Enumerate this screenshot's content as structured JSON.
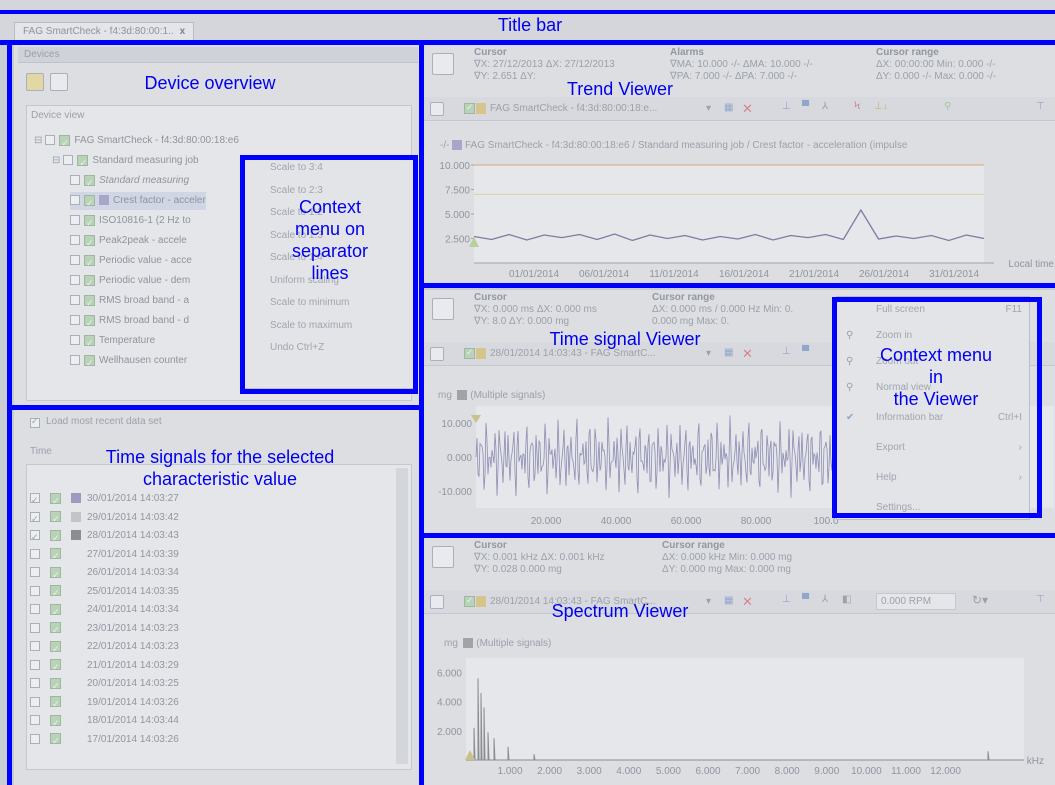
{
  "window": {
    "tab_label": "FAG SmartCheck - f4:3d:80:00:1..",
    "tab_close": "x"
  },
  "annotations": {
    "title_bar": "Title bar",
    "device_overview": "Device overview",
    "context_separator": "Context\nmenu on\nseparator\nlines",
    "time_signals": "Time signals for the selected\ncharacteristic value",
    "trend_viewer": "Trend Viewer",
    "time_signal_viewer": "Time signal Viewer",
    "context_viewer": "Context menu\nin\nthe Viewer",
    "spectrum_viewer": "Spectrum Viewer"
  },
  "devices": {
    "header": "Devices",
    "device_view_label": "Device view",
    "tree": [
      {
        "label": "FAG SmartCheck - f4:3d:80:00:18:e6",
        "level": 0
      },
      {
        "label": "Standard measuring job",
        "level": 1
      },
      {
        "label": "Standard measuring",
        "level": 2,
        "italic": true
      },
      {
        "label": "Crest factor - acceler",
        "level": 2,
        "selected": true
      },
      {
        "label": "ISO10816-1 (2 Hz to",
        "level": 2
      },
      {
        "label": "Peak2peak - accele",
        "level": 2
      },
      {
        "label": "Periodic value - acce",
        "level": 2
      },
      {
        "label": "Periodic value - dem",
        "level": 2
      },
      {
        "label": "RMS broad band - a",
        "level": 2
      },
      {
        "label": "RMS broad band - d",
        "level": 2
      },
      {
        "label": "Temperature",
        "level": 2
      },
      {
        "label": "Wellhausen counter",
        "level": 2
      }
    ]
  },
  "separator_menu": {
    "items": [
      "Scale to 3:4",
      "Scale to 2:3",
      "Scale to 1:2",
      "Scale to 1:3",
      "Scale to 1:4",
      "Uniform scaling",
      "Scale to minimum",
      "Scale to maximum",
      "Undo   Ctrl+Z"
    ]
  },
  "time_signals": {
    "load_recent": "Load most recent data set",
    "time_col": "Time",
    "rows": [
      {
        "date": "30/01/2014 14:03:27",
        "checked": true,
        "color": "#9d9ac2"
      },
      {
        "date": "29/01/2014 14:03:42",
        "checked": true,
        "color": "#c3c4c8"
      },
      {
        "date": "28/01/2014 14:03:43",
        "checked": true,
        "color": "#8c8d91"
      },
      {
        "date": "27/01/2014 14:03:39",
        "checked": false,
        "color": ""
      },
      {
        "date": "26/01/2014 14:03:34",
        "checked": false,
        "color": ""
      },
      {
        "date": "25/01/2014 14:03:35",
        "checked": false,
        "color": ""
      },
      {
        "date": "24/01/2014 14:03:34",
        "checked": false,
        "color": ""
      },
      {
        "date": "23/01/2014 14:03:23",
        "checked": false,
        "color": ""
      },
      {
        "date": "22/01/2014 14:03:23",
        "checked": false,
        "color": ""
      },
      {
        "date": "21/01/2014 14:03:29",
        "checked": false,
        "color": ""
      },
      {
        "date": "20/01/2014 14:03:25",
        "checked": false,
        "color": ""
      },
      {
        "date": "19/01/2014 14:03:26",
        "checked": false,
        "color": ""
      },
      {
        "date": "18/01/2014 14:03:44",
        "checked": false,
        "color": ""
      },
      {
        "date": "17/01/2014 14:03:26",
        "checked": false,
        "color": ""
      }
    ]
  },
  "trend": {
    "cursor_title": "Cursor",
    "cursor_line1": "∇X: 27/12/2013  ΔX: 27/12/2013",
    "cursor_line2": "∇Y:    2.651  ΔY:",
    "alarms_title": "Alarms",
    "alarms_line1": "∇MA: 10.000 -/-   ΔMA: 10.000 -/-",
    "alarms_line2": "∇PA:  7.000 -/-   ΔPA:  7.000 -/-",
    "range_title": "Cursor range",
    "range_line1": "ΔX: 00:00:00    Min:  0.000 -/-",
    "range_line2": "ΔY:  0.000 -/-   Max:  0.000 -/-",
    "device_combo": "FAG SmartCheck - f4:3d:80:00:18:e...",
    "legend": "FAG SmartCheck - f4:3d:80:00:18:e6 / Standard measuring job / Crest factor - acceleration (impulse",
    "x_axis_title": "Local time"
  },
  "time_signal": {
    "cursor_title": "Cursor",
    "cursor_line1": "∇X: 0.000 ms   ΔX: 0.000 ms",
    "cursor_line2": "∇Y: 8.0      ΔY: 0.000 mg",
    "range_title": "Cursor range",
    "range_line1": "ΔX: 0.000 ms / 0.000 Hz    Min:  0.",
    "range_line2": "            0.000 mg    Max:  0.",
    "combo": "28/01/2014 14:03:43 - FAG SmartC...",
    "unit": "mg",
    "legend": "(Multiple signals)"
  },
  "viewer_menu": {
    "items": [
      {
        "label": "Full screen",
        "shortcut": "F11"
      },
      {
        "label": "Zoom in",
        "shortcut": ""
      },
      {
        "label": "Zoom out",
        "shortcut": ""
      },
      {
        "label": "Normal view",
        "shortcut": ""
      },
      {
        "label": "Information bar",
        "shortcut": "Ctrl+I"
      },
      {
        "label": "Export",
        "shortcut": "›"
      },
      {
        "label": "Help",
        "shortcut": "›"
      },
      {
        "label": "Settings...",
        "shortcut": ""
      }
    ]
  },
  "spectrum": {
    "cursor_title": "Cursor",
    "cursor_line1": "∇X: 0.001 kHz   ΔX: 0.001 kHz",
    "cursor_line2": "∇Y: 0.028        0.000 mg",
    "range_title": "Cursor range",
    "range_line1": "ΔX: 0.000 kHz    Min:  0.000 mg",
    "range_line2": "ΔY: 0.000 mg   Max:  0.000 mg",
    "combo": "28/01/2014 14:03:43 - FAG SmartC...",
    "rpm": "0.000 RPM",
    "unit": "mg",
    "legend": "(Multiple signals)"
  },
  "chart_data": [
    {
      "type": "line",
      "title": "",
      "xlabel": "Local time",
      "ylabel": "",
      "ylim": [
        0,
        10000
      ],
      "y_ticks": [
        "10.000",
        "7.500",
        "5.000",
        "2.500"
      ],
      "x_ticks": [
        "01/01/2014",
        "06/01/2014",
        "11/01/2014",
        "16/01/2014",
        "21/01/2014",
        "26/01/2014",
        "31/01/2014"
      ],
      "thresholds": [
        {
          "name": "MA",
          "value": 10000,
          "color": "#d9a97a"
        },
        {
          "name": "PA",
          "value": 7000,
          "color": "#d8d39a"
        }
      ],
      "series": [
        {
          "values": [
            2500,
            2600,
            2700,
            2550,
            2650,
            2800,
            2700,
            2600,
            2750,
            2500,
            2650,
            2700,
            2600,
            2550,
            2500,
            2650,
            2700,
            2550,
            2600,
            2800,
            2700,
            2600,
            5200,
            2650,
            2550,
            2700,
            2600,
            2500,
            2650,
            2700
          ],
          "color": "#7e7aa3"
        }
      ]
    },
    {
      "type": "line",
      "title": "",
      "xlabel": "",
      "ylabel": "mg",
      "ylim": [
        -15000,
        15000
      ],
      "y_ticks": [
        "10.000",
        "0.000",
        "-10.000"
      ],
      "x_ticks": [
        "20.000",
        "40.000",
        "60.000",
        "80.000",
        "100.0"
      ],
      "series": [
        {
          "name": "(Multiple signals)",
          "color": "#8d8cb3"
        }
      ]
    },
    {
      "type": "line",
      "title": "",
      "xlabel": "kHz",
      "ylabel": "mg",
      "ylim": [
        0,
        7000
      ],
      "y_ticks": [
        "6.000",
        "4.000",
        "2.000"
      ],
      "x_ticks": [
        "1.000",
        "2.000",
        "3.000",
        "4.000",
        "5.000",
        "6.000",
        "7.000",
        "8.000",
        "9.000",
        "10.000",
        "11.000",
        "12.000"
      ],
      "series": [
        {
          "name": "(Multiple signals)",
          "color": "#8a8c92"
        }
      ]
    }
  ]
}
